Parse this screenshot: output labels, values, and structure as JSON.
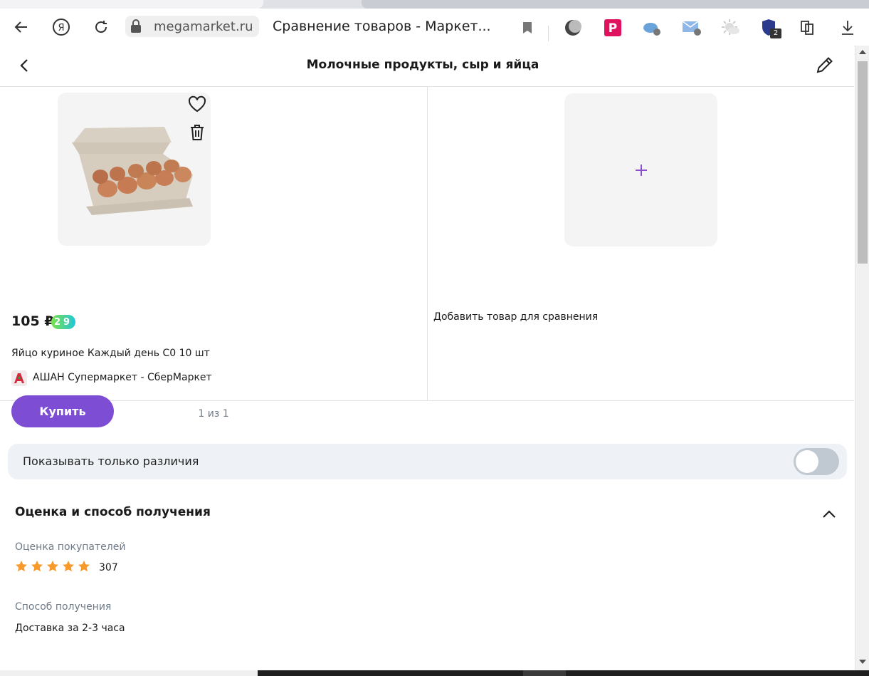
{
  "browser": {
    "url": "megamarket.ru",
    "tab_title": "Сравнение товаров - Маркет...",
    "ext_badge": "2"
  },
  "header": {
    "title": "Молочные продукты, сыр и яйца"
  },
  "product": {
    "price": "105 ₽",
    "bonus_badge": "29",
    "name": "Яйцо куриное Каждый день С0 10 шт",
    "shop": "АШАН Супермаркет - СберМаркет",
    "buy_label": "Купить"
  },
  "add_slot": {
    "text": "Добавить товар для сравнения"
  },
  "pager": "1 из 1",
  "diff_toggle": {
    "label": "Показывать только различия",
    "on": false
  },
  "section": {
    "title": "Оценка и способ получения",
    "rating_label": "Оценка покупателей",
    "rating_stars": 5,
    "rating_count": "307",
    "delivery_label": "Способ получения",
    "delivery_value": "Доставка за 2-3 часа"
  },
  "colors": {
    "accent": "#7d4ed3",
    "star": "#f79a2b",
    "muted": "#6f7a87"
  }
}
